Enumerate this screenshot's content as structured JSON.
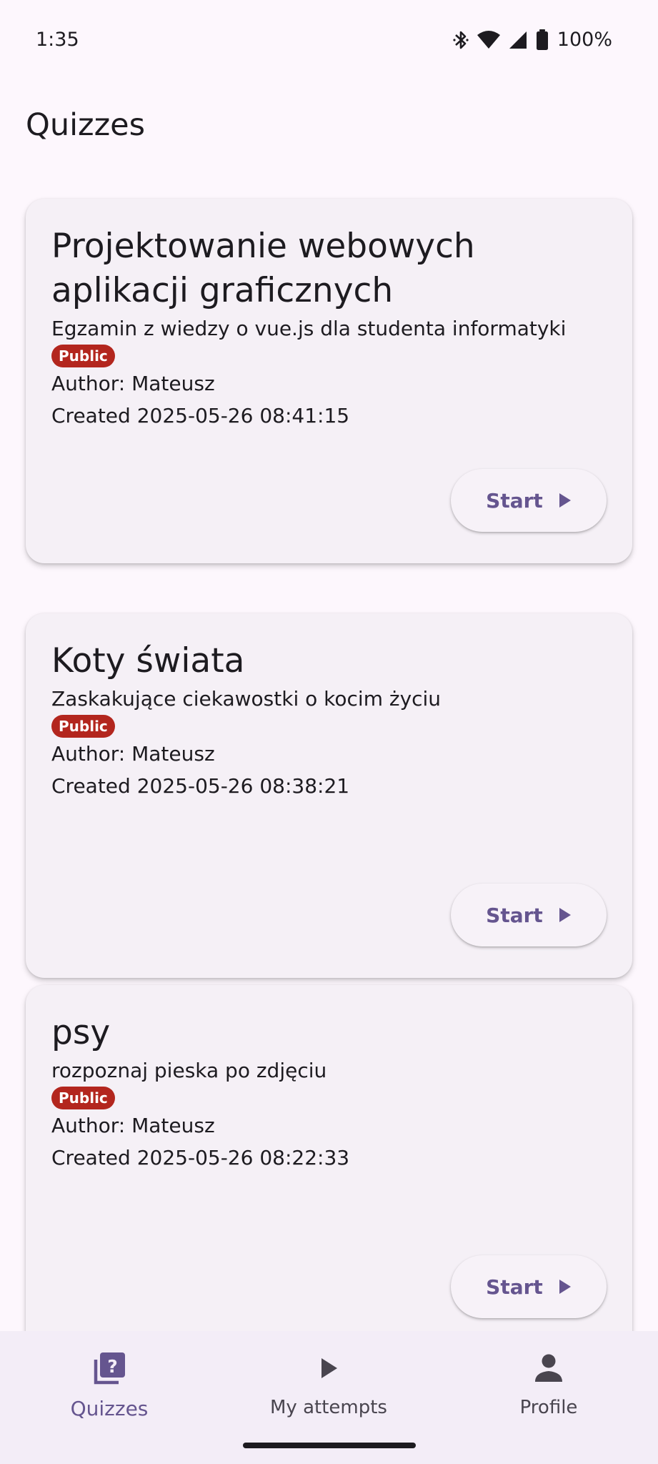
{
  "status_bar": {
    "time": "1:35",
    "battery_text": "100%",
    "icons": [
      "bluetooth-icon",
      "wifi-icon",
      "cell-signal-icon",
      "battery-icon"
    ]
  },
  "app_bar": {
    "title": "Quizzes"
  },
  "quizzes": [
    {
      "title": "Projektowanie webowych aplikacji graficznych",
      "description": "Egzamin z wiedzy o vue.js dla studenta informatyki",
      "badge": "Public",
      "author": "Author: Mateusz",
      "created": "Created 2025-05-26 08:41:15",
      "button_label": "Start"
    },
    {
      "title": "Koty świata",
      "description": "Zaskakujące ciekawostki o kocim życiu",
      "badge": "Public",
      "author": "Author: Mateusz",
      "created": "Created 2025-05-26 08:38:21",
      "button_label": "Start"
    },
    {
      "title": "psy",
      "description": "rozpoznaj pieska po zdjęciu",
      "badge": "Public",
      "author": "Author: Mateusz",
      "created": "Created 2025-05-26 08:22:33",
      "button_label": "Start"
    }
  ],
  "bottom_nav": {
    "items": [
      {
        "label": "Quizzes",
        "icon": "quiz-icon",
        "active": true
      },
      {
        "label": "My attempts",
        "icon": "play-icon",
        "active": false
      },
      {
        "label": "Profile",
        "icon": "person-icon",
        "active": false
      }
    ]
  },
  "colors": {
    "background": "#FDF7FD",
    "card": "#F5F0F6",
    "primary": "#65558F",
    "badge": "#B3261E",
    "text": "#1D1B20"
  }
}
